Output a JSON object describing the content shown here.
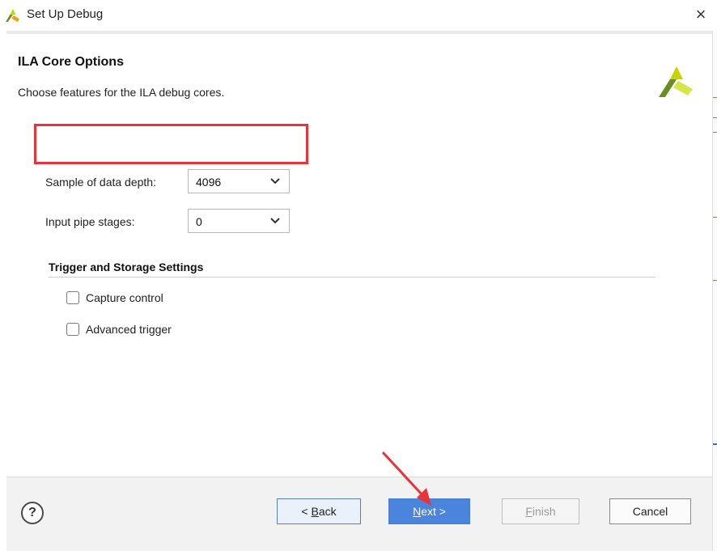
{
  "window": {
    "title": "Set Up Debug",
    "close_glyph": "×",
    "logo_icon": "xilinx-logo-icon"
  },
  "page": {
    "heading": "ILA Core Options",
    "subheading": "Choose features for the ILA debug cores."
  },
  "fields": {
    "sample_depth": {
      "label": "Sample of data depth:",
      "value": "4096"
    },
    "input_pipe": {
      "label": "Input pipe stages:",
      "value": "0"
    }
  },
  "trigger_storage": {
    "title": "Trigger and Storage Settings",
    "capture_control": {
      "label": "Capture control",
      "checked": false
    },
    "advanced_trigger": {
      "label": "Advanced trigger",
      "checked": false
    }
  },
  "footer": {
    "help_glyph": "?",
    "back": {
      "prefix": "< ",
      "mnemonic": "B",
      "rest": "ack"
    },
    "next": {
      "mnemonic": "N",
      "rest": "ext >"
    },
    "finish": {
      "mnemonic": "F",
      "rest": "inish"
    },
    "cancel": "Cancel"
  },
  "colors": {
    "highlight_box": "#e8333a",
    "annotation_arrow": "#e8333a",
    "next_button": "#4b84dc",
    "logo_dark": "#6b8e23",
    "logo_light": "#c8d400"
  }
}
